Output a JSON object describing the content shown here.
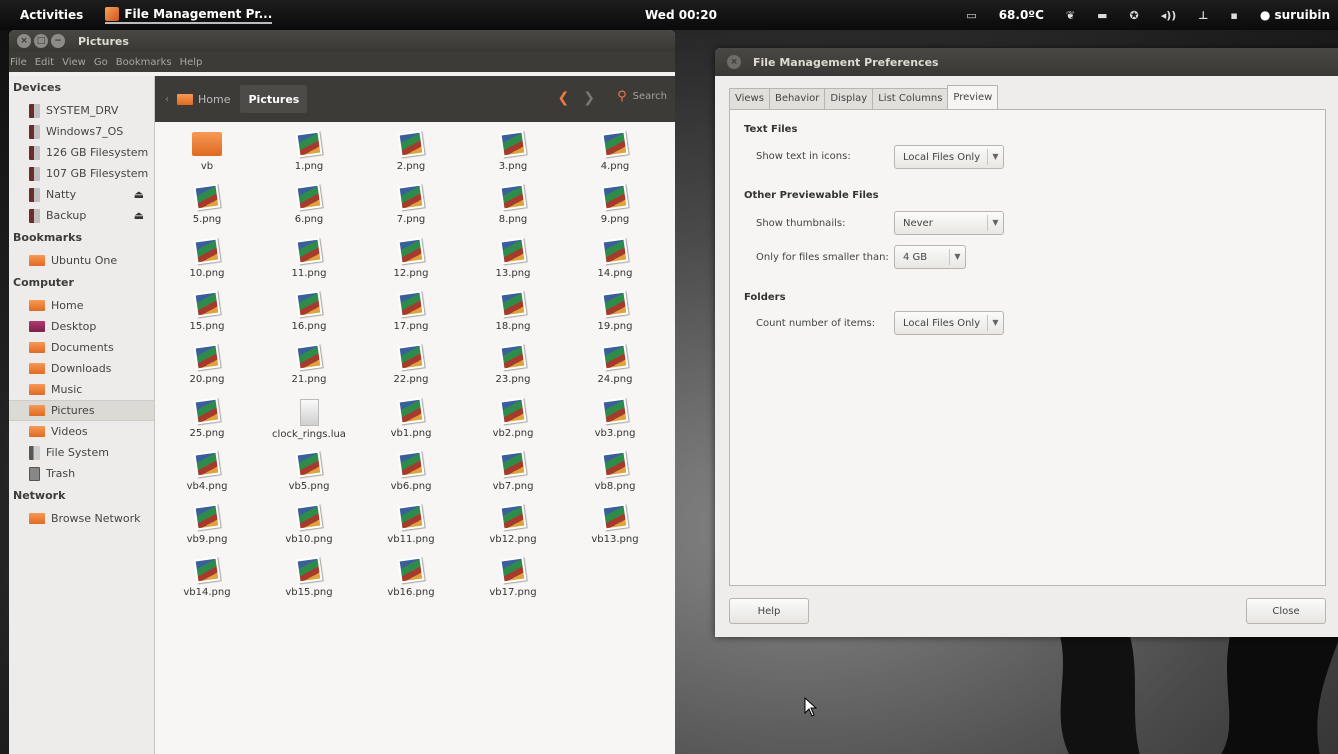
{
  "top_panel": {
    "activities": "Activities",
    "active_app": "File Management Pr...",
    "clock": "Wed 00:20",
    "temperature": "68.0ºC",
    "user": "suruibin"
  },
  "nautilus": {
    "title": "Pictures",
    "menu": [
      "File",
      "Edit",
      "View",
      "Go",
      "Bookmarks",
      "Help"
    ],
    "sidebar": {
      "devices_heading": "Devices",
      "devices": [
        "SYSTEM_DRV",
        "Windows7_OS",
        "126 GB Filesystem",
        "107 GB Filesystem",
        "Natty",
        "Backup"
      ],
      "bookmarks_heading": "Bookmarks",
      "bookmarks": [
        "Ubuntu One"
      ],
      "computer_heading": "Computer",
      "computer": [
        "Home",
        "Desktop",
        "Documents",
        "Downloads",
        "Music",
        "Pictures",
        "Videos",
        "File System",
        "Trash"
      ],
      "network_heading": "Network",
      "network": [
        "Browse Network"
      ]
    },
    "path": {
      "home": "Home",
      "current": "Pictures"
    },
    "search_label": "Search",
    "files": [
      "vb",
      "1.png",
      "2.png",
      "3.png",
      "4.png",
      "5.png",
      "6.png",
      "7.png",
      "8.png",
      "9.png",
      "10.png",
      "11.png",
      "12.png",
      "13.png",
      "14.png",
      "15.png",
      "16.png",
      "17.png",
      "18.png",
      "19.png",
      "20.png",
      "21.png",
      "22.png",
      "23.png",
      "24.png",
      "25.png",
      "clock_rings.lua",
      "vb1.png",
      "vb2.png",
      "vb3.png",
      "vb4.png",
      "vb5.png",
      "vb6.png",
      "vb7.png",
      "vb8.png",
      "vb9.png",
      "vb10.png",
      "vb11.png",
      "vb12.png",
      "vb13.png",
      "vb14.png",
      "vb15.png",
      "vb16.png",
      "vb17.png"
    ]
  },
  "prefs": {
    "title": "File Management Preferences",
    "tabs": [
      "Views",
      "Behavior",
      "Display",
      "List Columns",
      "Preview"
    ],
    "text_files_heading": "Text Files",
    "show_text_label": "Show text in icons:",
    "show_text_value": "Local Files Only",
    "other_heading": "Other Previewable Files",
    "thumbnails_label": "Show thumbnails:",
    "thumbnails_value": "Never",
    "smaller_label": "Only for files smaller than:",
    "smaller_value": "4 GB",
    "folders_heading": "Folders",
    "count_label": "Count number of items:",
    "count_value": "Local Files Only",
    "help_button": "Help",
    "close_button": "Close"
  },
  "colors": {
    "accent_orange": "#f07746",
    "titlebar": "#3c3b37",
    "panel_bg": "#0a0a0a"
  }
}
